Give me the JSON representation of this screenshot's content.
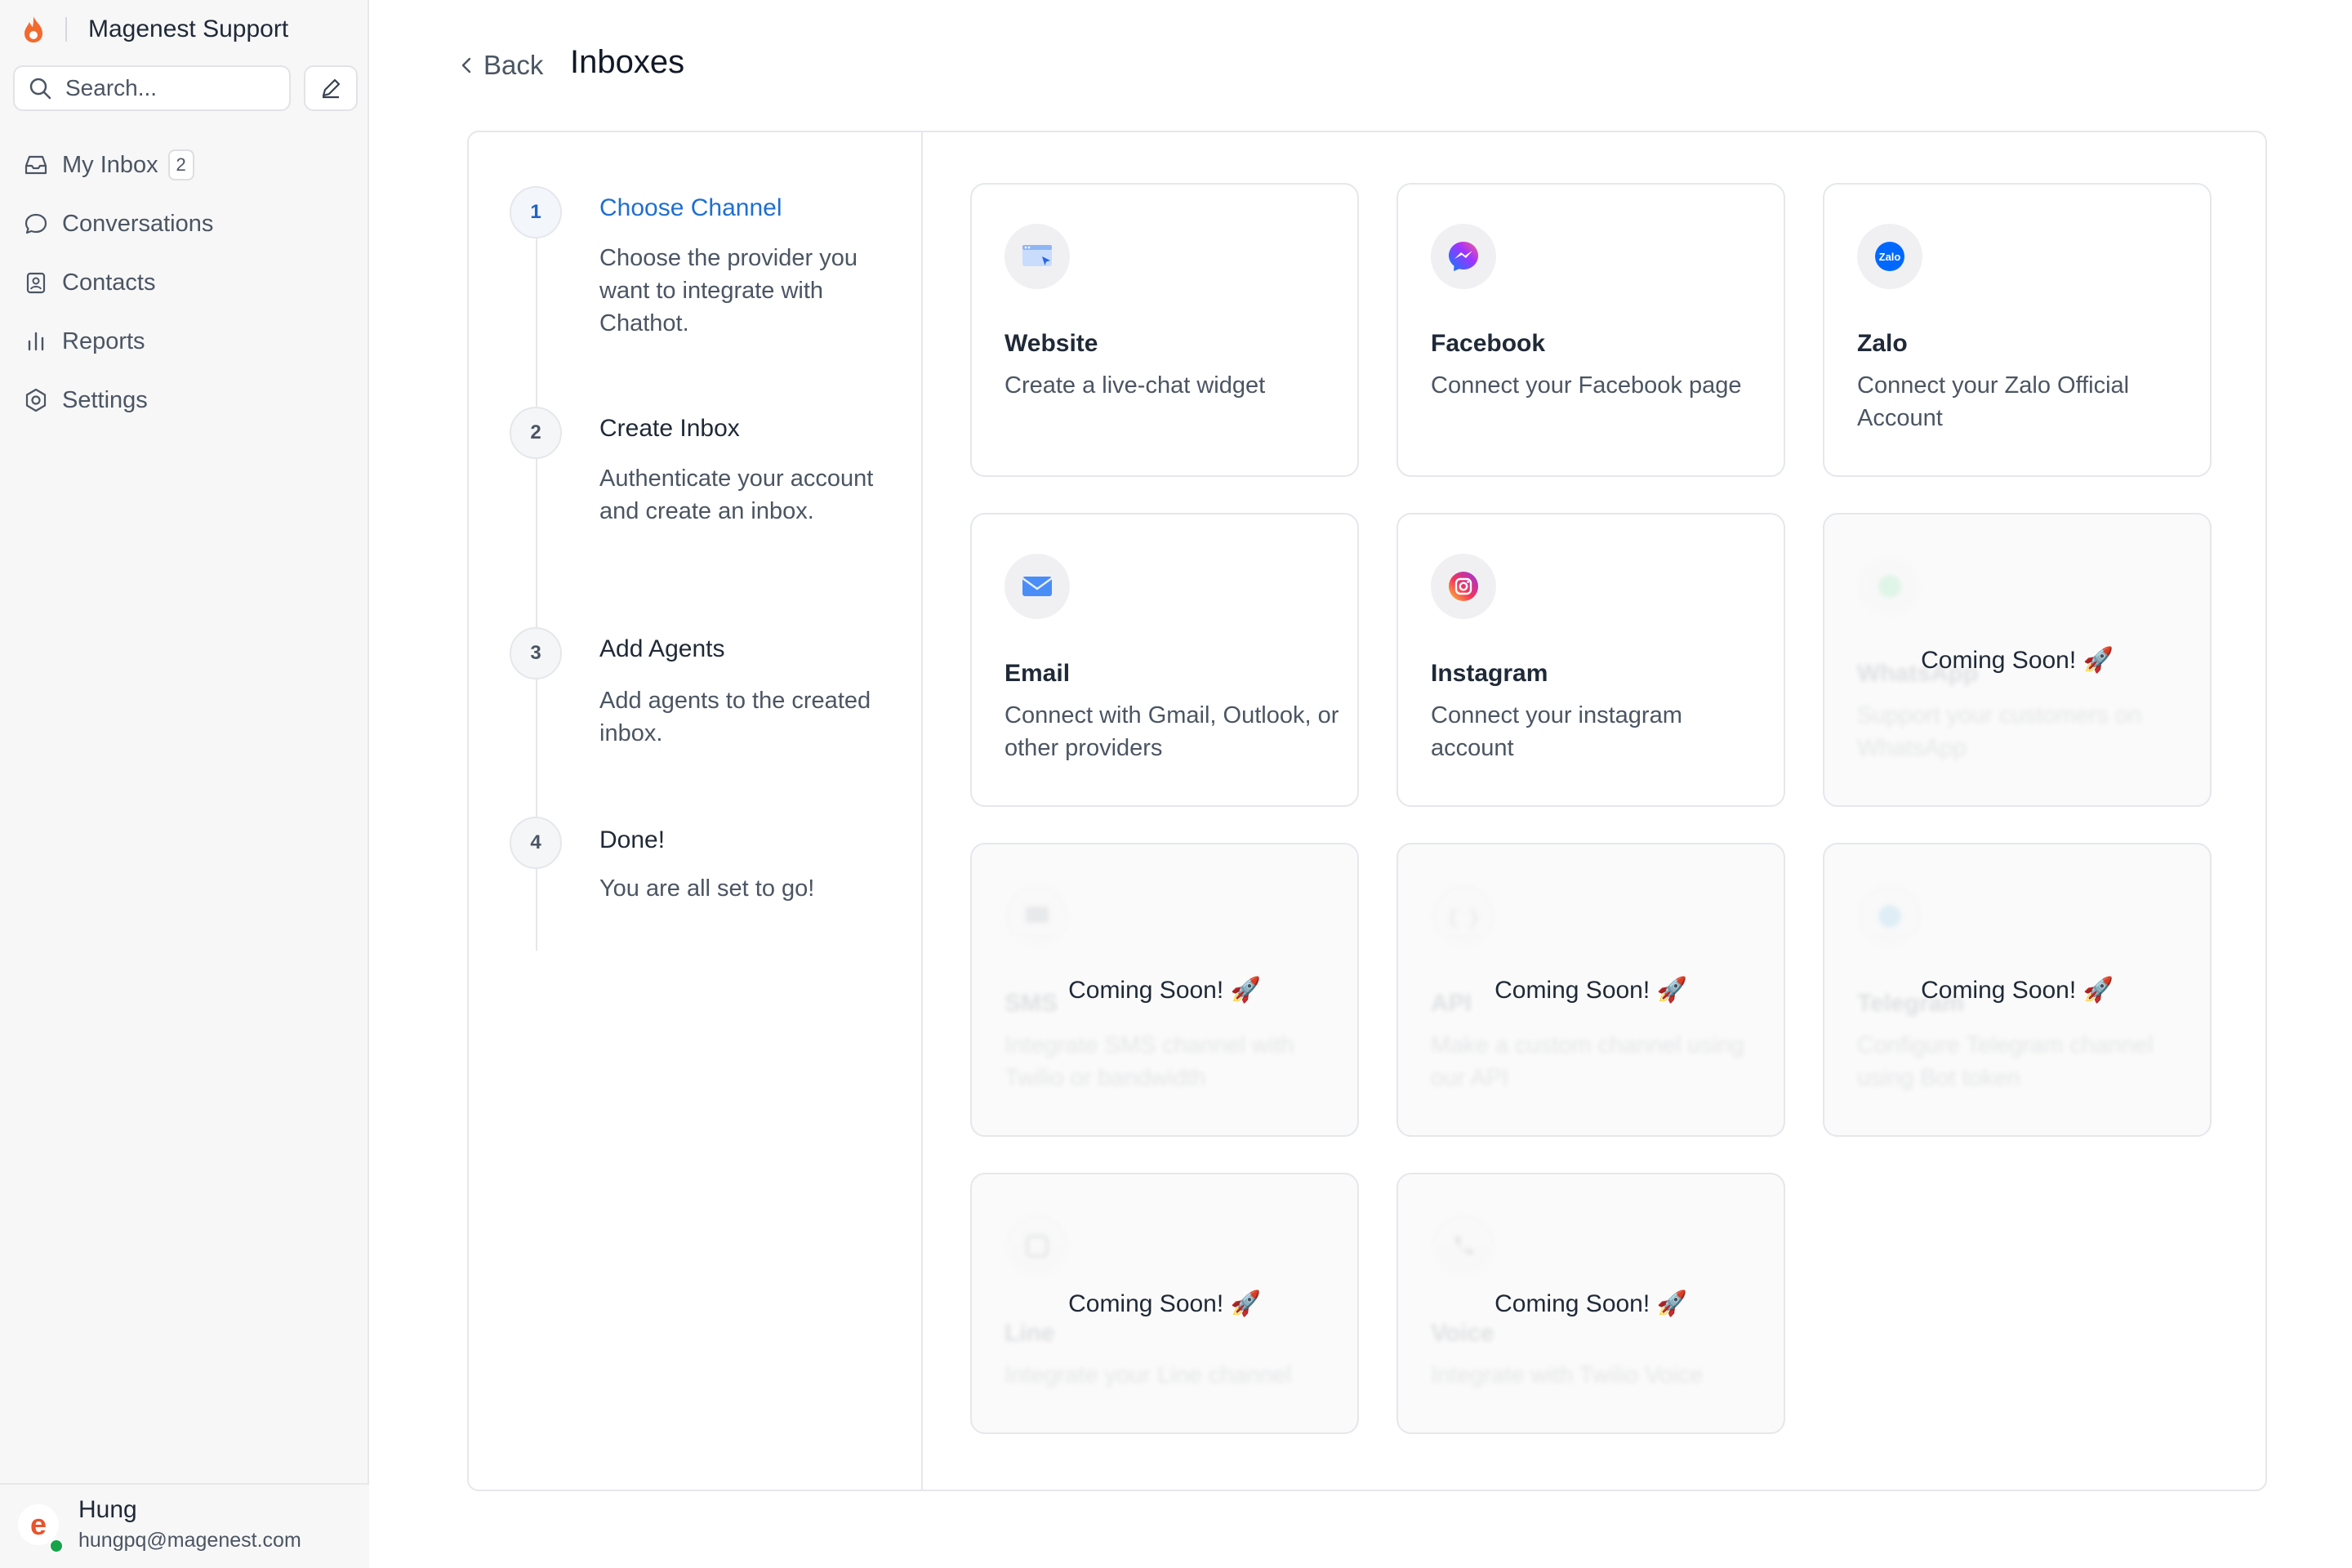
{
  "sidebar": {
    "brand_name": "Magenest Support",
    "search_placeholder": "Search...",
    "nav": [
      {
        "label": "My Inbox",
        "badge": "2",
        "icon": "inbox-icon"
      },
      {
        "label": "Conversations",
        "icon": "chat-bubble-icon"
      },
      {
        "label": "Contacts",
        "icon": "contact-card-icon"
      },
      {
        "label": "Reports",
        "icon": "bar-chart-icon"
      },
      {
        "label": "Settings",
        "icon": "gear-icon"
      }
    ],
    "user": {
      "name": "Hung",
      "email": "hungpq@magenest.com",
      "avatar_letter": "e",
      "status_color": "#17a34a"
    }
  },
  "header": {
    "back_label": "Back",
    "title": "Inboxes"
  },
  "steps": [
    {
      "number": "1",
      "title": "Choose Channel",
      "desc": "Choose the provider you want to integrate with Chathot.",
      "active": true
    },
    {
      "number": "2",
      "title": "Create Inbox",
      "desc": "Authenticate your account and create an inbox."
    },
    {
      "number": "3",
      "title": "Add Agents",
      "desc": "Add agents to the created inbox."
    },
    {
      "number": "4",
      "title": "Done!",
      "desc": "You are all set to go!"
    }
  ],
  "channels": [
    {
      "title": "Website",
      "desc": "Create a live-chat widget",
      "icon": "website-window-icon",
      "available": true
    },
    {
      "title": "Facebook",
      "desc": "Connect your Facebook page",
      "icon": "messenger-icon",
      "available": true
    },
    {
      "title": "Zalo",
      "desc": "Connect your Zalo Official Account",
      "icon": "zalo-icon",
      "available": true
    },
    {
      "title": "Email",
      "desc": "Connect with Gmail, Outlook, or other providers",
      "icon": "envelope-icon",
      "available": true
    },
    {
      "title": "Instagram",
      "desc": "Connect your instagram account",
      "icon": "instagram-icon",
      "available": true
    },
    {
      "title": "WhatsApp",
      "desc": "Support your customers on WhatsApp",
      "icon": "whatsapp-icon",
      "available": false
    },
    {
      "title": "SMS",
      "desc": "Integrate SMS channel with Twilio or bandwidth",
      "icon": "sms-icon",
      "available": false
    },
    {
      "title": "API",
      "desc": "Make a custom channel using our API",
      "icon": "code-braces-icon",
      "available": false
    },
    {
      "title": "Telegram",
      "desc": "Configure Telegram channel using Bot token",
      "icon": "telegram-icon",
      "available": false
    },
    {
      "title": "Line",
      "desc": "Integrate your Line channel",
      "icon": "line-icon",
      "available": false
    },
    {
      "title": "Voice",
      "desc": "Integrate with Twilio Voice",
      "icon": "phone-icon",
      "available": false
    }
  ],
  "coming_soon_label": "Coming Soon! 🚀",
  "colors": {
    "accent": "#1f6fd1",
    "brand": "#e8542c"
  }
}
